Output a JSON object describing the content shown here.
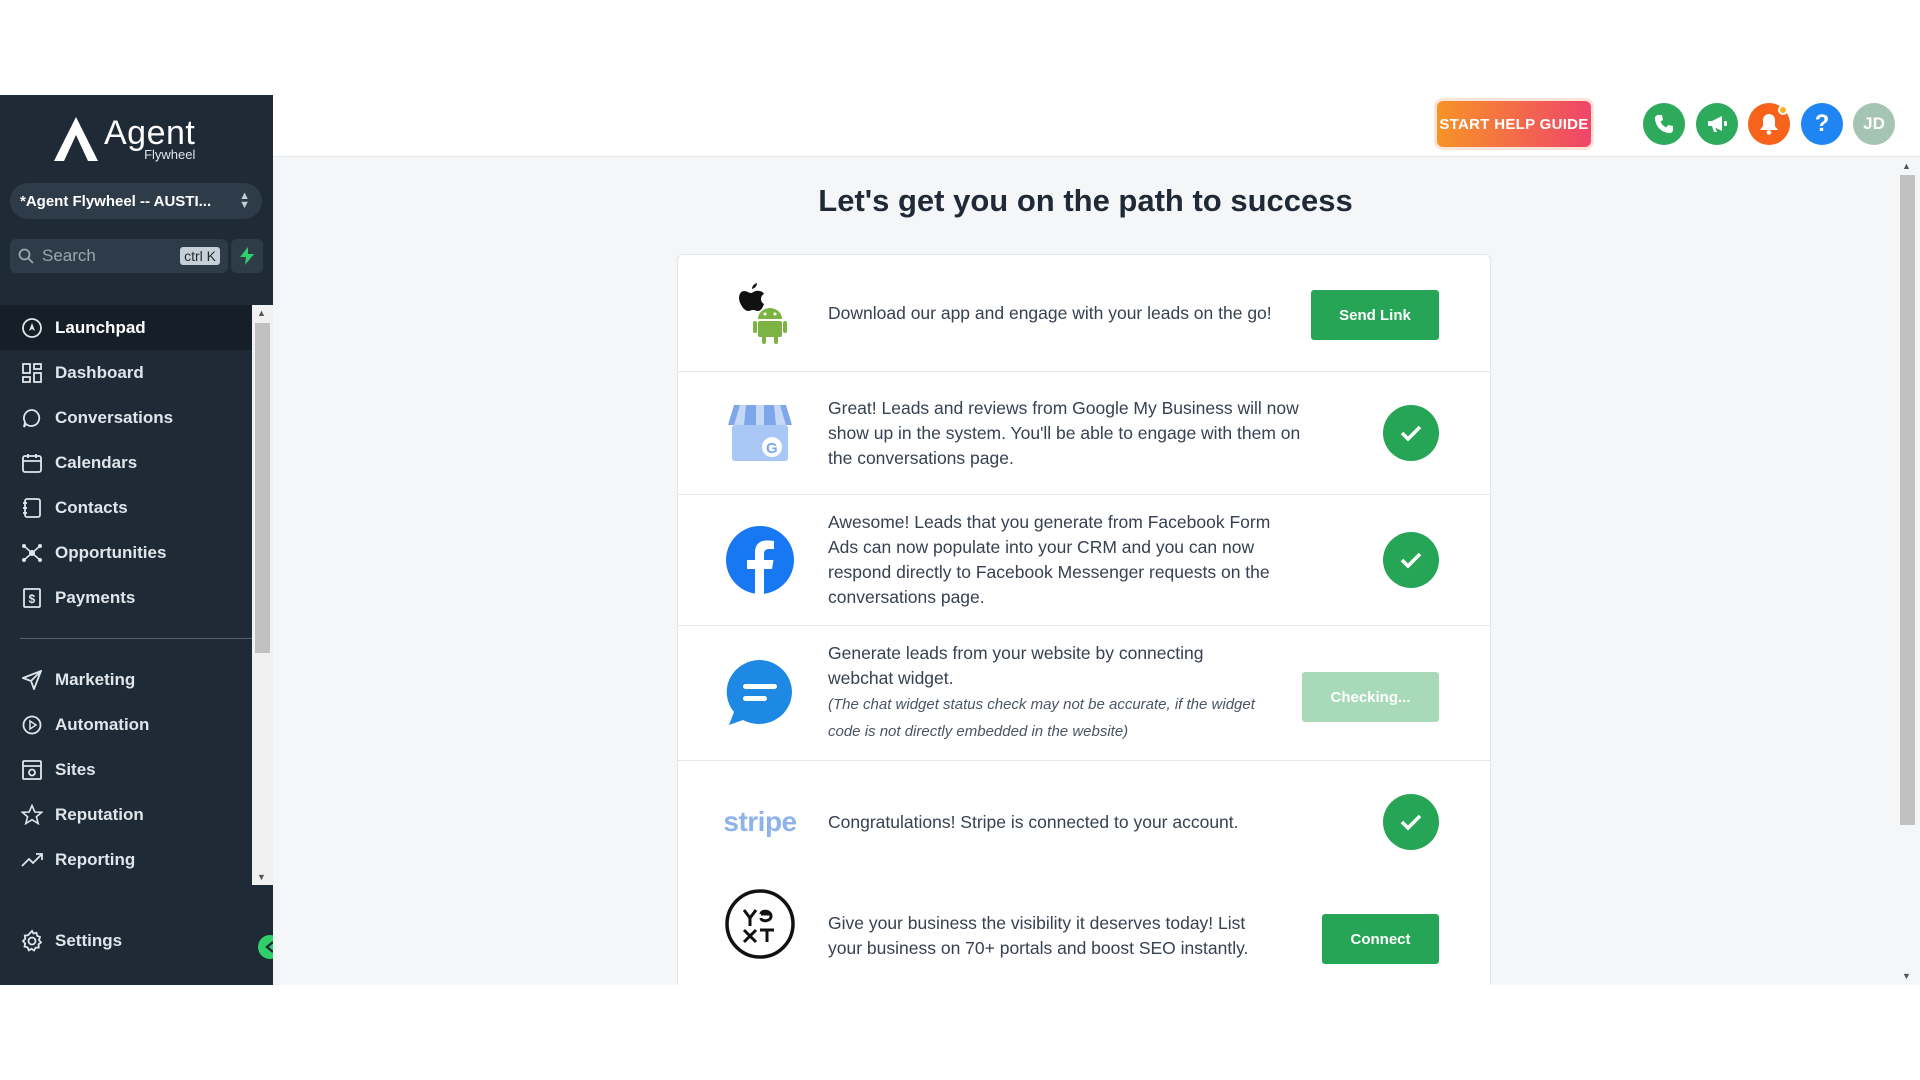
{
  "brand": {
    "name": "Agent",
    "tagline": "Flywheel"
  },
  "account": {
    "name": "*Agent Flywheel -- AUSTI..."
  },
  "search": {
    "placeholder": "Search",
    "shortcut": "ctrl K"
  },
  "sidebar": {
    "items": [
      {
        "label": "Launchpad",
        "icon": "launchpad-icon",
        "active": true
      },
      {
        "label": "Dashboard",
        "icon": "dashboard-icon"
      },
      {
        "label": "Conversations",
        "icon": "chat-bubble-icon"
      },
      {
        "label": "Calendars",
        "icon": "calendar-icon"
      },
      {
        "label": "Contacts",
        "icon": "contacts-icon"
      },
      {
        "label": "Opportunities",
        "icon": "opportunities-icon"
      },
      {
        "label": "Payments",
        "icon": "payments-icon"
      }
    ],
    "items2": [
      {
        "label": "Marketing",
        "icon": "send-icon"
      },
      {
        "label": "Automation",
        "icon": "automation-icon"
      },
      {
        "label": "Sites",
        "icon": "sites-icon"
      },
      {
        "label": "Reputation",
        "icon": "star-icon"
      },
      {
        "label": "Reporting",
        "icon": "trend-icon"
      }
    ],
    "settings_label": "Settings"
  },
  "header": {
    "help_label": "START HELP GUIDE",
    "avatar_initials": "JD",
    "help_icon_text": "?"
  },
  "main": {
    "title": "Let's get you on the path to success",
    "rows": {
      "app": {
        "text": "Download our app and engage with your leads on the go!",
        "button": "Send Link"
      },
      "gmb": {
        "text": "Great! Leads and reviews from Google My Business will now show up in the system. You'll be able to engage with them on the conversations page."
      },
      "facebook": {
        "text": "Awesome! Leads that you generate from Facebook Form Ads can now populate into your CRM and you can now respond directly to Facebook Messenger requests on the conversations page."
      },
      "webchat": {
        "text": "Generate leads from your website by connecting webchat widget.",
        "note": "(The chat widget status check may not be accurate, if the widget code is not directly embedded in the website)",
        "button": "Checking..."
      },
      "stripe": {
        "logo_text": "stripe",
        "text": "Congratulations! Stripe is connected to your account."
      },
      "yext": {
        "logo_text": "ye xt",
        "text": "Give your business the visibility it deserves today! List your business on 70+ portals and boost SEO instantly.",
        "button": "Connect"
      }
    }
  },
  "colors": {
    "sidebar_bg": "#1e2a36",
    "accent_green": "#27a556",
    "help_gradient_start": "#f79326",
    "help_gradient_end": "#f0456a"
  }
}
